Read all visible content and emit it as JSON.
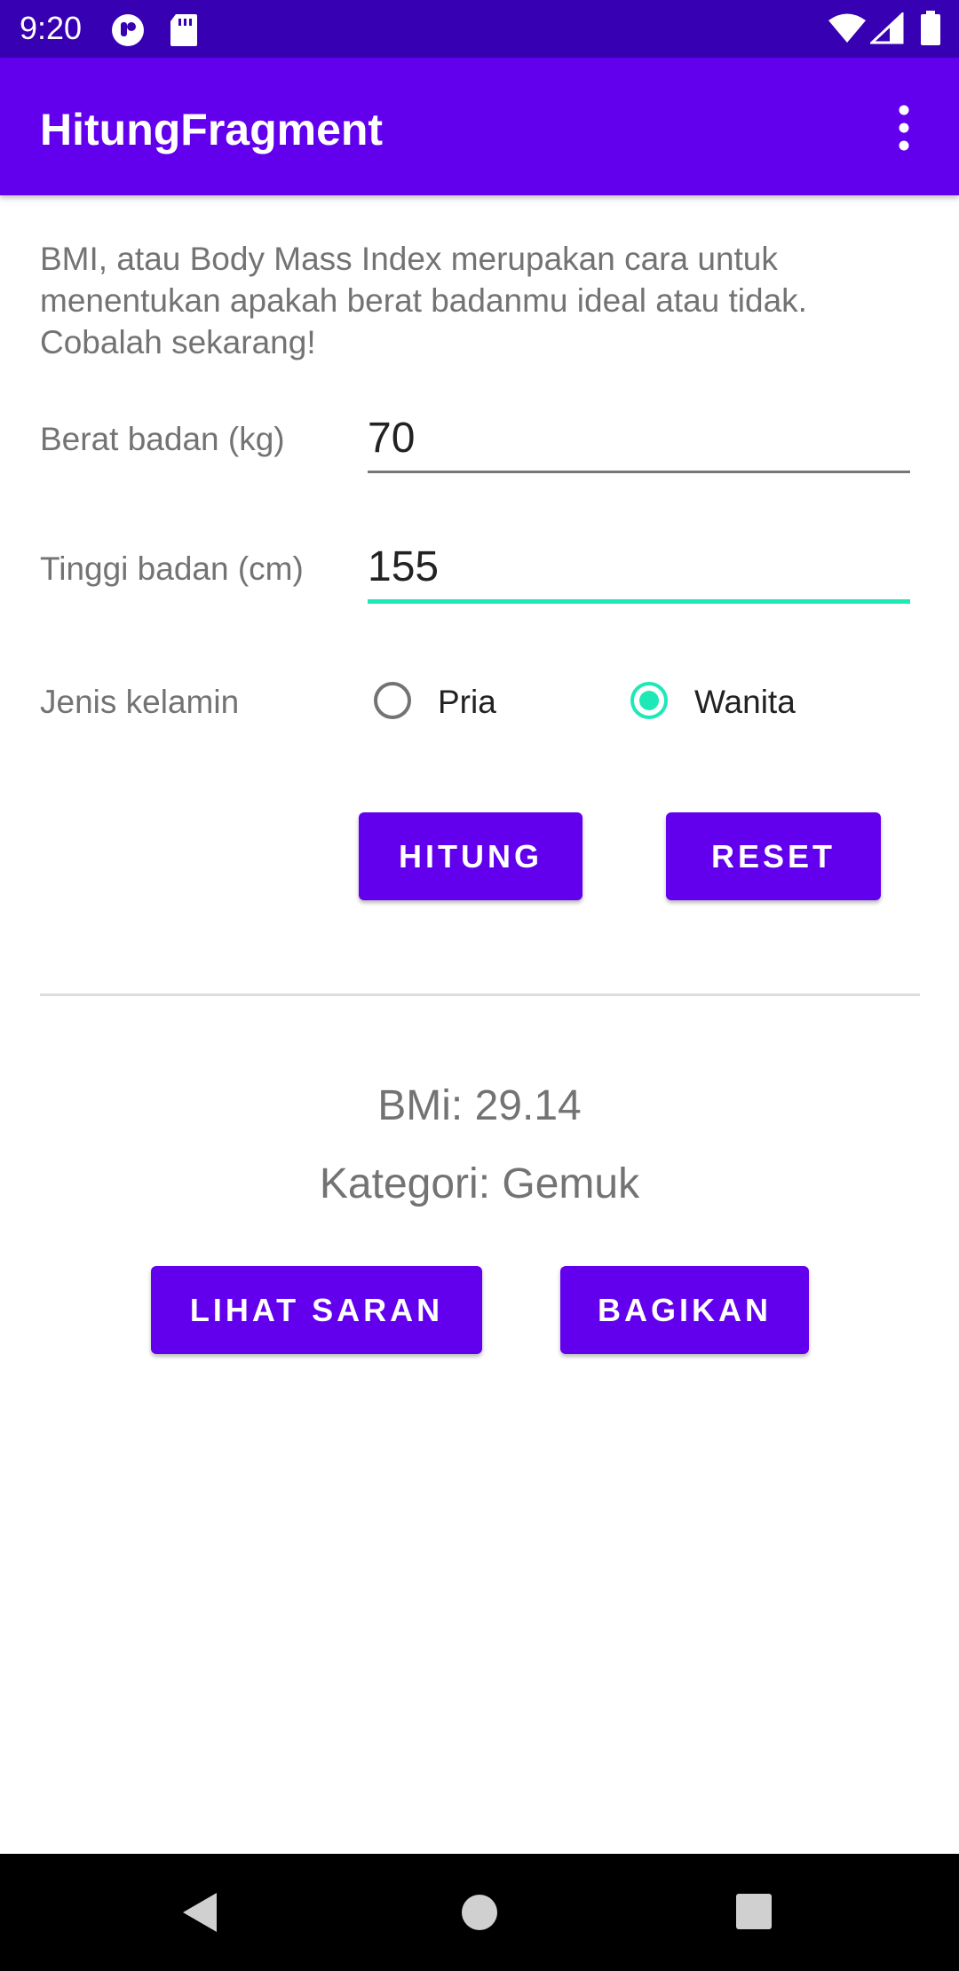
{
  "status_bar": {
    "time": "9:20",
    "icons": [
      "notification-icon",
      "sd-card-icon",
      "wifi-icon",
      "signal-icon",
      "battery-icon"
    ]
  },
  "app_bar": {
    "title": "HitungFragment",
    "menu_icon": "more-vert-icon"
  },
  "form": {
    "intro": "BMI, atau Body Mass Index merupakan cara untuk menentukan apakah berat badanmu ideal atau tidak. Cobalah sekarang!",
    "weight_label": "Berat badan (kg)",
    "weight_value": "70",
    "height_label": "Tinggi badan (cm)",
    "height_value": "155",
    "gender_label": "Jenis kelamin",
    "gender_options": [
      "Pria",
      "Wanita"
    ],
    "gender_selected": "Wanita",
    "hitung_label": "HITUNG",
    "reset_label": "RESET"
  },
  "result": {
    "bmi_text": "BMi: 29.14",
    "category_text": "Kategori: Gemuk",
    "advice_label": "LIHAT SARAN",
    "share_label": "BAGIKAN"
  },
  "nav_bar": {
    "icons": [
      "back-icon",
      "home-icon",
      "recents-icon"
    ]
  },
  "colors": {
    "primary": "#6200EE",
    "primary_dark": "#3700B3",
    "accent": "#1DE9B6",
    "secondary_text": "#737373"
  }
}
